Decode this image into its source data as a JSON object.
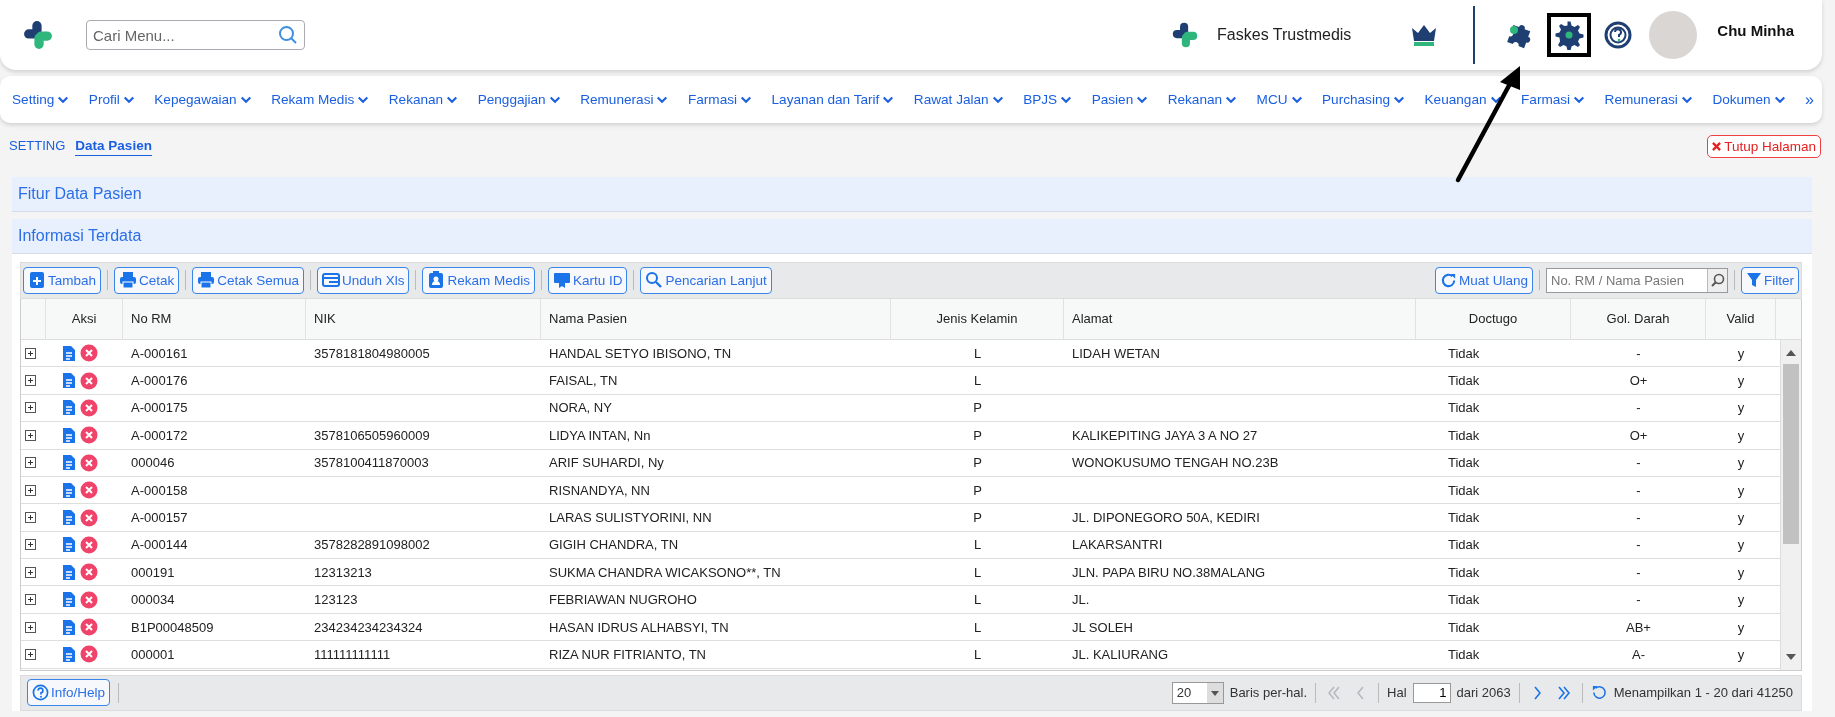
{
  "header": {
    "search": {
      "placeholder": "Cari Menu..."
    },
    "facility": "Faskes Trustmedis",
    "tools": [
      {
        "kind": "crown",
        "highlighted": false
      },
      {
        "kind": "puzzle",
        "highlighted": false
      },
      {
        "kind": "gear",
        "highlighted": true
      },
      {
        "kind": "help",
        "highlighted": false
      }
    ],
    "user": "Chu Minha"
  },
  "nav": {
    "items": [
      "Setting",
      "Profil",
      "Kepegawaian",
      "Rekam Medis",
      "Rekanan",
      "Penggajian",
      "Remunerasi",
      "Farmasi",
      "Layanan dan Tarif",
      "Rawat Jalan",
      "BPJS",
      "Pasien",
      "Rekanan",
      "MCU",
      "Purchasing",
      "Keuangan",
      "Farmasi",
      "Remunerasi",
      "Dokumen"
    ],
    "more": "»"
  },
  "breadcrumb": [
    {
      "label": "SETTING",
      "selected": false
    },
    {
      "label": "Data Pasien",
      "selected": true
    }
  ],
  "close_button": "Tutup Halaman",
  "sections": [
    "Fitur Data Pasien",
    "Informasi Terdata"
  ],
  "toolbar": {
    "buttons": [
      "Tambah",
      "Cetak",
      "Cetak Semua",
      "Unduh Xls",
      "Rekam Medis",
      "Kartu ID",
      "Pencarian Lanjut"
    ],
    "reload": "Muat Ulang",
    "search": {
      "placeholder": "No. RM / Nama Pasien"
    },
    "filter": "Filter"
  },
  "table": {
    "columns": [
      "Aksi",
      "No RM",
      "NIK",
      "Nama Pasien",
      "Jenis Kelamin",
      "Alamat",
      "Doctugo",
      "Gol. Darah",
      "Valid"
    ],
    "rows": [
      {
        "no_rm": "A-000161",
        "nik": "3578181804980005",
        "nama": "HANDAL SETYO IBISONO, TN",
        "jk": "L",
        "alamat": "LIDAH WETAN",
        "doctugo": "Tidak",
        "gol": "-",
        "valid": "y"
      },
      {
        "no_rm": "A-000176",
        "nama": "FAISAL, TN",
        "jk": "L",
        "doctugo": "Tidak",
        "gol": "O+",
        "valid": "y"
      },
      {
        "no_rm": "A-000175",
        "nama": "NORA, NY",
        "jk": "P",
        "doctugo": "Tidak",
        "gol": "-",
        "valid": "y"
      },
      {
        "no_rm": "A-000172",
        "nik": "3578106505960009",
        "nama": "LIDYA INTAN, Nn",
        "jk": "P",
        "alamat": "KALIKEPITING JAYA 3 A NO 27",
        "doctugo": "Tidak",
        "gol": "O+",
        "valid": "y"
      },
      {
        "no_rm": "000046",
        "nik": "3578100411870003",
        "nama": "ARIF SUHARDI, Ny",
        "jk": "P",
        "alamat": "WONOKUSUMO TENGAH NO.23B",
        "doctugo": "Tidak",
        "gol": "-",
        "valid": "y"
      },
      {
        "no_rm": "A-000158",
        "nama": "RISNANDYA, NN",
        "jk": "P",
        "doctugo": "Tidak",
        "gol": "-",
        "valid": "y"
      },
      {
        "no_rm": "A-000157",
        "nama": "LARAS SULISTYORINI, NN",
        "jk": "P",
        "alamat": "JL. DIPONEGORO 50A, KEDIRI",
        "doctugo": "Tidak",
        "gol": "-",
        "valid": "y"
      },
      {
        "no_rm": "A-000144",
        "nik": "3578282891098002",
        "nama": "GIGIH CHANDRA, TN",
        "jk": "L",
        "alamat": "LAKARSANTRI",
        "doctugo": "Tidak",
        "gol": "-",
        "valid": "y"
      },
      {
        "no_rm": "000191",
        "nik": "12313213",
        "nama": "SUKMA CHANDRA WICAKSONO**, TN",
        "jk": "L",
        "alamat": "JLN. PAPA BIRU NO.38MALANG",
        "doctugo": "Tidak",
        "gol": "-",
        "valid": "y"
      },
      {
        "no_rm": "000034",
        "nik": "123123",
        "nama": "FEBRIAWAN NUGROHO",
        "jk": "L",
        "alamat": "JL.",
        "doctugo": "Tidak",
        "gol": "-",
        "valid": "y"
      },
      {
        "no_rm": "B1P00048509",
        "nik": "234234234234324",
        "nama": "HASAN IDRUS ALHABSYI, TN",
        "jk": "L",
        "alamat": "JL SOLEH",
        "doctugo": "Tidak",
        "gol": "AB+",
        "valid": "y"
      },
      {
        "no_rm": "000001",
        "nik": "111111111111",
        "nama": "RIZA NUR FITRIANTO, TN",
        "jk": "L",
        "alamat": "JL. KALIURANG",
        "doctugo": "Tidak",
        "gol": "A-",
        "valid": "y"
      }
    ]
  },
  "footer": {
    "help": "Info/Help",
    "page_size": "20",
    "page_size_label": "Baris per-hal.",
    "pager": [
      {
        "kind": "first",
        "disabled": true
      },
      {
        "kind": "prev",
        "disabled": true
      },
      {
        "kind": "next",
        "disabled": false
      },
      {
        "kind": "last",
        "disabled": false
      }
    ],
    "page_label": "Hal",
    "page": "1",
    "page_total": "dari 2063",
    "summary": "Menampilkan 1 - 20 dari 41250"
  }
}
